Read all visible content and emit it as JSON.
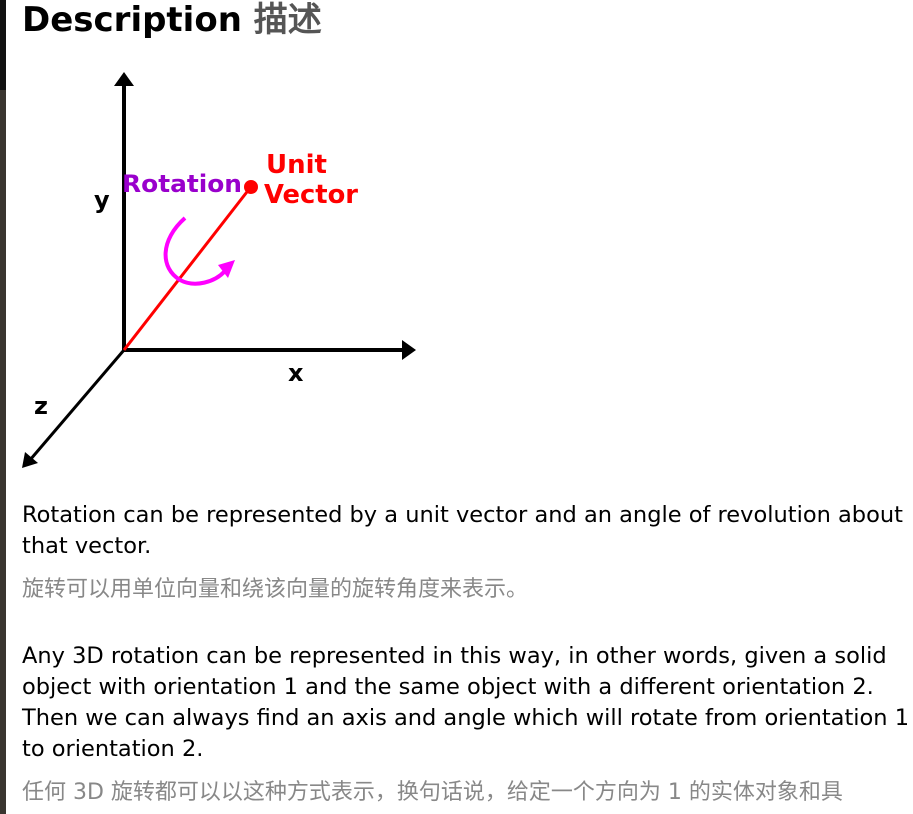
{
  "heading": {
    "en": "Description",
    "zh": "描述"
  },
  "figure": {
    "labels": {
      "y": "y",
      "x": "x",
      "z": "z",
      "rotation": "Rotation",
      "unit": "Unit",
      "vector": "Vector"
    },
    "colors": {
      "axes": "#000000",
      "vector": "#ff0000",
      "rotation_label": "#9900cc",
      "rotation_arrow": "#ff00ff"
    }
  },
  "paragraphs": [
    {
      "en_lines": [
        "Rotation can be represented by a unit vector and an angle of revolution about",
        "that vector."
      ],
      "zh": "旋转可以用单位向量和绕该向量的旋转角度来表示。"
    },
    {
      "en_lines": [
        "Any 3D rotation can be represented in this way, in other words, given a solid",
        "object with orientation 1 and the same object with a different orientation 2.",
        "Then we can always find an axis and angle which will rotate from orientation 1",
        "to orientation 2."
      ],
      "zh": "任何 3D 旋转都可以以这种方式表示，换句话说，给定一个方向为 1 的实体对象和具"
    }
  ]
}
